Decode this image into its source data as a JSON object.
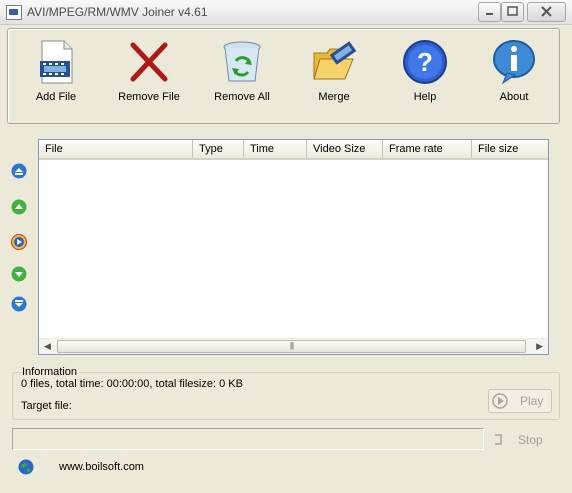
{
  "window": {
    "title": "AVI/MPEG/RM/WMV Joiner v4.61"
  },
  "toolbar": {
    "buttons": [
      {
        "label": "Add File",
        "icon": "film-document-icon"
      },
      {
        "label": "Remove File",
        "icon": "red-x-icon"
      },
      {
        "label": "Remove All",
        "icon": "recycle-bin-icon"
      },
      {
        "label": "Merge",
        "icon": "folder-film-icon"
      },
      {
        "label": "Help",
        "icon": "question-icon"
      },
      {
        "label": "About",
        "icon": "info-icon"
      }
    ]
  },
  "list": {
    "columns": [
      "File",
      "Type",
      "Time",
      "Video Size",
      "Frame rate",
      "File size"
    ],
    "rows": []
  },
  "info": {
    "legend": "Information",
    "summary": "0 files, total time: 00:00:00, total filesize: 0 KB",
    "target_label": "Target file:"
  },
  "actions": {
    "play_label": "Play",
    "stop_label": "Stop"
  },
  "footer": {
    "link": "www.boilsoft.com"
  }
}
